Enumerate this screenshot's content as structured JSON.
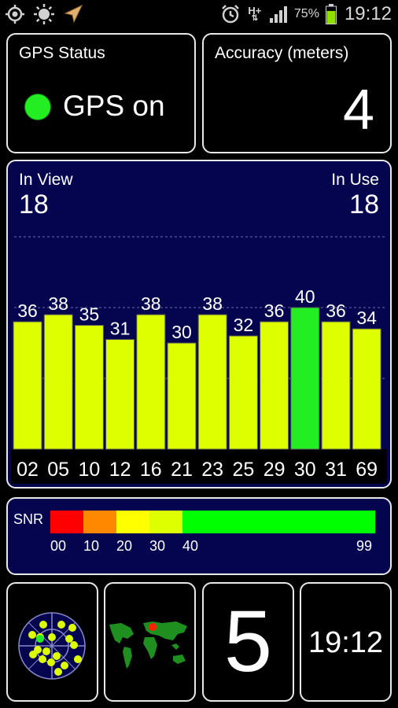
{
  "status_bar": {
    "icons": [
      "gps-target-icon",
      "brightness-icon",
      "location-arrow-icon",
      "alarm-clock-icon",
      "network-hplus-icon",
      "signal-icon",
      "battery-icon"
    ],
    "network_label": "H+",
    "battery_percent": "75%",
    "battery_level": 0.75,
    "time": "19:12"
  },
  "gps_status": {
    "title": "GPS Status",
    "text": "GPS on",
    "indicator_color": "#22ee22"
  },
  "accuracy": {
    "title": "Accuracy (meters)",
    "value": "4"
  },
  "satellites": {
    "in_view_label": "In View",
    "in_view_value": "18",
    "in_use_label": "In Use",
    "in_use_value": "18"
  },
  "chart_data": {
    "type": "bar",
    "categories": [
      "02",
      "05",
      "10",
      "12",
      "16",
      "21",
      "23",
      "25",
      "29",
      "30",
      "31",
      "69"
    ],
    "values": [
      36,
      38,
      35,
      31,
      38,
      30,
      38,
      32,
      36,
      40,
      36,
      34
    ],
    "ylim": [
      0,
      60
    ],
    "bar_colors": [
      "#ddff00",
      "#ddff00",
      "#ddff00",
      "#ddff00",
      "#ddff00",
      "#ddff00",
      "#ddff00",
      "#ddff00",
      "#ddff00",
      "#22ee22",
      "#ddff00",
      "#ddff00"
    ],
    "gridlines": [
      20,
      40,
      60
    ]
  },
  "snr_legend": {
    "label": "SNR",
    "ticks": [
      "00",
      "10",
      "20",
      "30",
      "40",
      "99"
    ],
    "segments": [
      {
        "from": 0,
        "to": 10,
        "color": "#ff0000"
      },
      {
        "from": 10,
        "to": 20,
        "color": "#ff8800"
      },
      {
        "from": 20,
        "to": 30,
        "color": "#ffff00"
      },
      {
        "from": 30,
        "to": 40,
        "color": "#ddff00"
      },
      {
        "from": 40,
        "to": 99,
        "color": "#00ff00"
      }
    ]
  },
  "satellite_count": "5",
  "clock": "19:12",
  "colors": {
    "panel_blue": "#05054f",
    "bar_yellow": "#ddff00",
    "bar_green": "#22ee22",
    "border": "#e8e8e8"
  }
}
